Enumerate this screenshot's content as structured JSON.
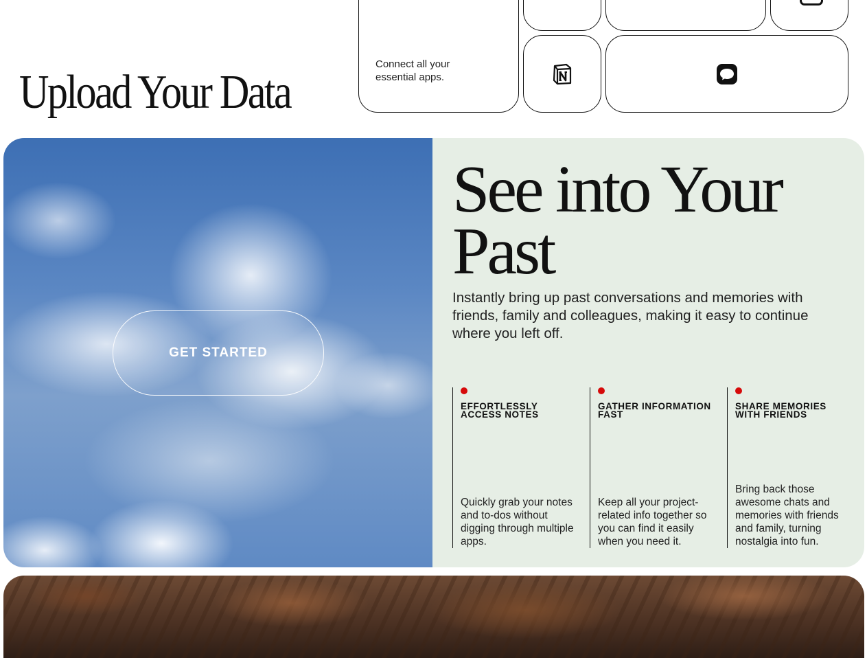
{
  "upload": {
    "title": "Upload Your Data",
    "connect_text": "Connect all your essential apps.",
    "icons": [
      "notion-icon",
      "imessage-icon"
    ]
  },
  "hero": {
    "button_label": "GET STARTED"
  },
  "feature": {
    "title": "See into Your Past",
    "description": "Instantly bring up past conversations and memories with friends, family and colleagues, making it easy to continue where you left off.",
    "accent_color": "#d60a0a",
    "panel_color": "#e6eee5",
    "columns": [
      {
        "title": "EFFORTLESSLY ACCESS NOTES",
        "text": "Quickly grab your notes and to-dos without digging through multiple apps."
      },
      {
        "title": "GATHER INFORMATION FAST",
        "text": "Keep all your project-related info together so you can find it easily when you need it."
      },
      {
        "title": "SHARE MEMORIES WITH FRIENDS",
        "text": "Bring back those awesome chats and memories with friends and family, turning nostalgia into fun."
      }
    ]
  }
}
